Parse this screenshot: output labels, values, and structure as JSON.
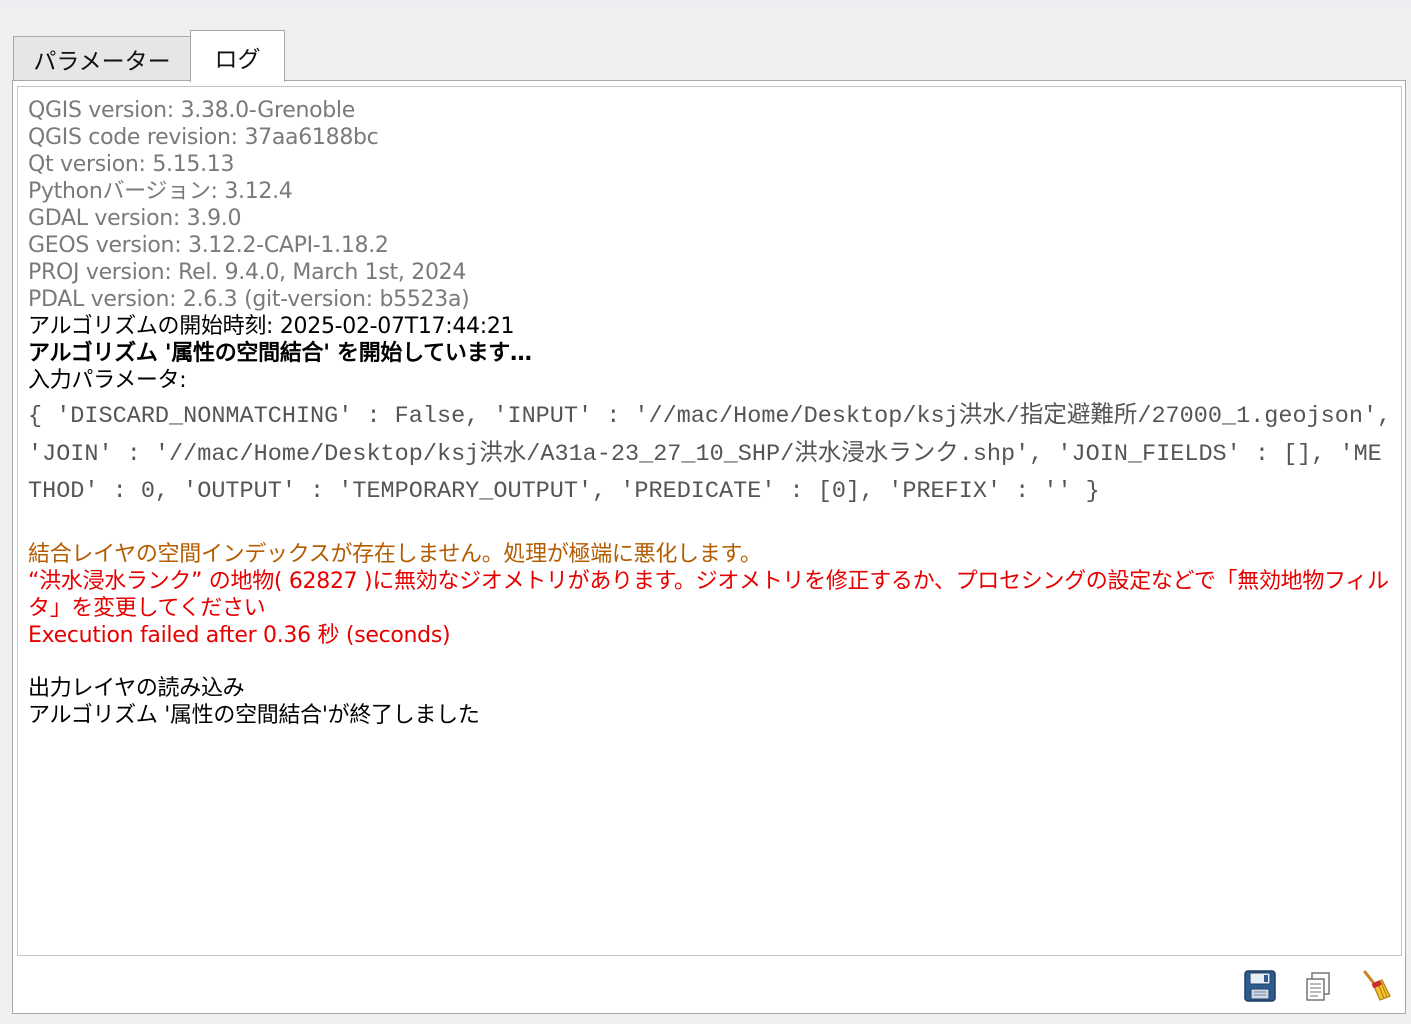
{
  "tabs": [
    {
      "label": "パラメーター",
      "active": false
    },
    {
      "label": "ログ",
      "active": true
    }
  ],
  "log": {
    "info_lines": [
      "QGIS version: 3.38.0-Grenoble",
      "QGIS code revision: 37aa6188bc",
      "Qt version: 5.15.13",
      "Pythonバージョン: 3.12.4",
      "GDAL version: 3.9.0",
      "GEOS version: 3.12.2-CAPI-1.18.2",
      "PROJ version: Rel. 9.4.0, March 1st, 2024",
      "PDAL version: 2.6.3 (git-version: b5523a)"
    ],
    "start_time": "アルゴリズムの開始時刻: 2025-02-07T17:44:21",
    "starting": "アルゴリズム '属性の空間結合' を開始しています…",
    "input_params_label": "入力パラメータ:",
    "params": "{ 'DISCARD_NONMATCHING' : False, 'INPUT' : '//mac/Home/Desktop/ksj洪水/指定避難所/27000_1.geojson', 'JOIN' : '//mac/Home/Desktop/ksj洪水/A31a-23_27_10_SHP/洪水浸水ランク.shp', 'JOIN_FIELDS' : [], 'METHOD' : 0, 'OUTPUT' : 'TEMPORARY_OUTPUT', 'PREDICATE' : [0], 'PREFIX' : '' }",
    "warning": "結合レイヤの空間インデックスが存在しません。処理が極端に悪化します。",
    "error_geometry": "“洪水浸水ランク” の地物( 62827 )に無効なジオメトリがあります。ジオメトリを修正するか、プロセシングの設定などで「無効地物フィルタ」を変更してください",
    "error_failed": "Execution failed after 0.36 秒 (seconds)",
    "loading": "出力レイヤの読み込み",
    "finished": "アルゴリズム '属性の空間結合'が終了しました"
  },
  "toolbar": {
    "buttons": [
      {
        "icon": "save-icon"
      },
      {
        "icon": "copy-icon"
      },
      {
        "icon": "clear-broom-icon"
      }
    ]
  },
  "colors": {
    "info_text": "#7a7a7a",
    "warning_text": "#b35c00",
    "error_text": "#e60000"
  }
}
